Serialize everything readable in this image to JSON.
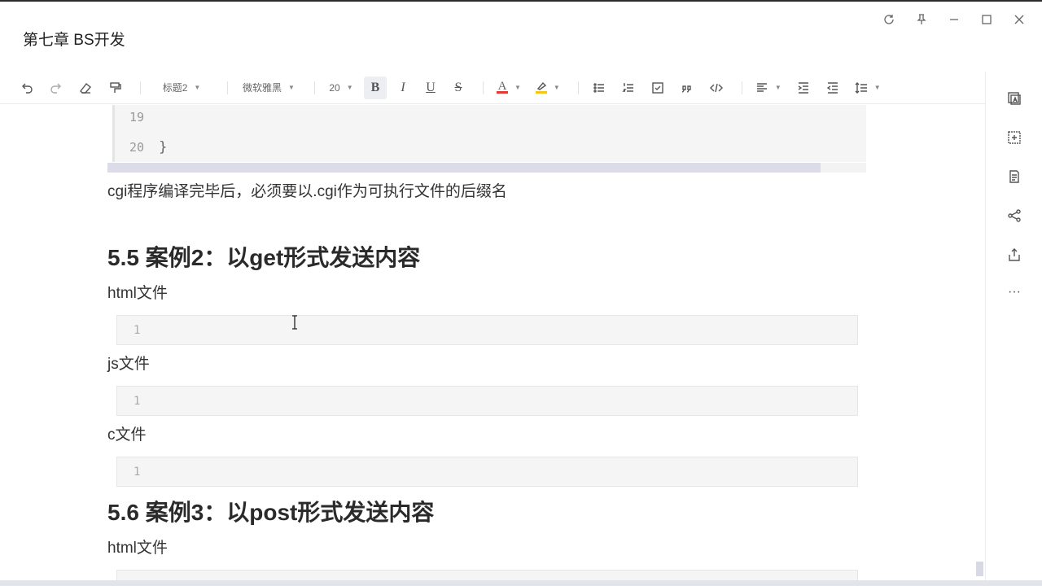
{
  "window": {
    "title": "第七章 BS开发",
    "controls": [
      {
        "name": "refresh-icon"
      },
      {
        "name": "pin-icon"
      },
      {
        "name": "minimize-icon"
      },
      {
        "name": "maximize-icon"
      },
      {
        "name": "close-icon"
      }
    ]
  },
  "toolbar": {
    "heading_style": "标题2",
    "font_family": "微软雅黑",
    "font_size": "20",
    "bold": "B",
    "italic": "I",
    "underline": "U",
    "strike": "S",
    "font_color": "A",
    "text_color_accent": "#e53935",
    "highlight_color_accent": "#f5c518"
  },
  "sidebar": {
    "items": [
      "template-icon",
      "insert-icon",
      "outline-icon",
      "share-icon",
      "export-icon",
      "more-icon"
    ]
  },
  "content": {
    "code_top": {
      "lines": [
        {
          "num": "19",
          "code": ""
        },
        {
          "num": "20",
          "code": "}"
        }
      ]
    },
    "para_cgi": "cgi程序编译完毕后，必须要以.cgi作为可执行文件的后缀名",
    "heading_55": "5.5 案例2：以get形式发送内容",
    "label_html_1": "html文件",
    "code_html_1": "1",
    "label_js": "js文件",
    "code_js": "1",
    "label_c": "c文件",
    "code_c": "1",
    "heading_56": "5.6 案例3：以post形式发送内容",
    "label_html_2": "html文件"
  }
}
